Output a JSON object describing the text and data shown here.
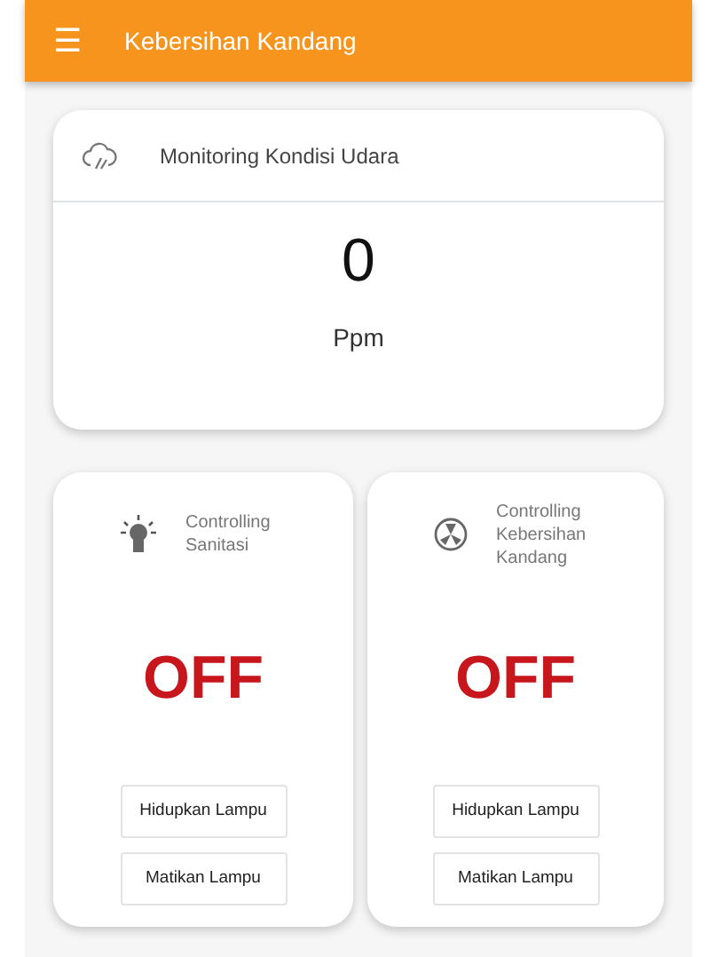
{
  "app_bar": {
    "menu_icon": "☰",
    "title": "Kebersihan Kandang"
  },
  "monitor": {
    "title": "Monitoring Kondisi Udara",
    "value": "0",
    "unit": "Ppm"
  },
  "controls": [
    {
      "kind": "bulb",
      "title": "Controlling Sanitasi",
      "status": "OFF",
      "buttons": [
        "Hidupkan Lampu",
        "Matikan Lampu"
      ]
    },
    {
      "kind": "fan",
      "title": "Controlling Kebersihan Kandang",
      "status": "OFF",
      "buttons": [
        "Hidupkan Lampu",
        "Matikan Lampu"
      ]
    }
  ]
}
